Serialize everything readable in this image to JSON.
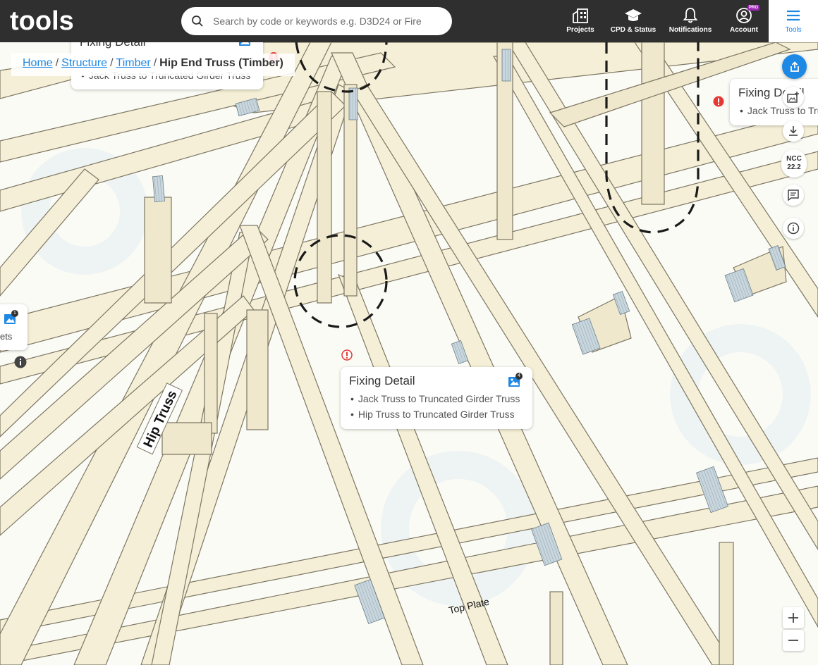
{
  "header": {
    "logo_text": "tools",
    "search": {
      "placeholder": "Search by code or keywords e.g. D3D24 or Fire",
      "value": ""
    },
    "nav": {
      "projects": "Projects",
      "cpd": "CPD & Status",
      "notifications": "Notifications",
      "account": "Account",
      "account_badge": "PRO",
      "tools": "Tools"
    }
  },
  "breadcrumb": {
    "home": "Home",
    "structure": "Structure",
    "timber": "Timber",
    "current": "Hip End Truss (Timber)",
    "separator": "/"
  },
  "drawing": {
    "labels": {
      "hip_truss": "Hip Truss",
      "top_plate": "Top Plate"
    }
  },
  "cards": {
    "main": {
      "title": "Fixing Detail",
      "items": [
        "Jack Truss to Truncated Girder Truss",
        "Hip Truss to Truncated Girder Truss"
      ],
      "image_count": "4"
    },
    "top_left": {
      "title": "Fixing Detail",
      "items": [
        "Jack Truss to Truncated Girder Truss"
      ]
    },
    "right": {
      "title": "Fixing Detail",
      "items": [
        "Jack Truss to Truncated Girder Truss"
      ]
    },
    "left": {
      "text": "ets",
      "image_count": "1"
    }
  },
  "toolbar": {
    "ncc_line1": "NCC",
    "ncc_line2": "22.2"
  },
  "colors": {
    "topbar": "#2f2f2f",
    "accent": "#1e88e5",
    "timber_fill": "#f4efd6",
    "alert": "#e53935",
    "pro": "#9c27b0"
  },
  "icons": [
    "search-icon",
    "projects-icon",
    "graduation-cap-icon",
    "bell-icon",
    "account-icon",
    "menu-icon",
    "share-icon",
    "add-image-icon",
    "download-icon",
    "comment-icon",
    "info-icon",
    "gallery-icon",
    "alert-icon",
    "zoom-in-icon",
    "zoom-out-icon"
  ]
}
